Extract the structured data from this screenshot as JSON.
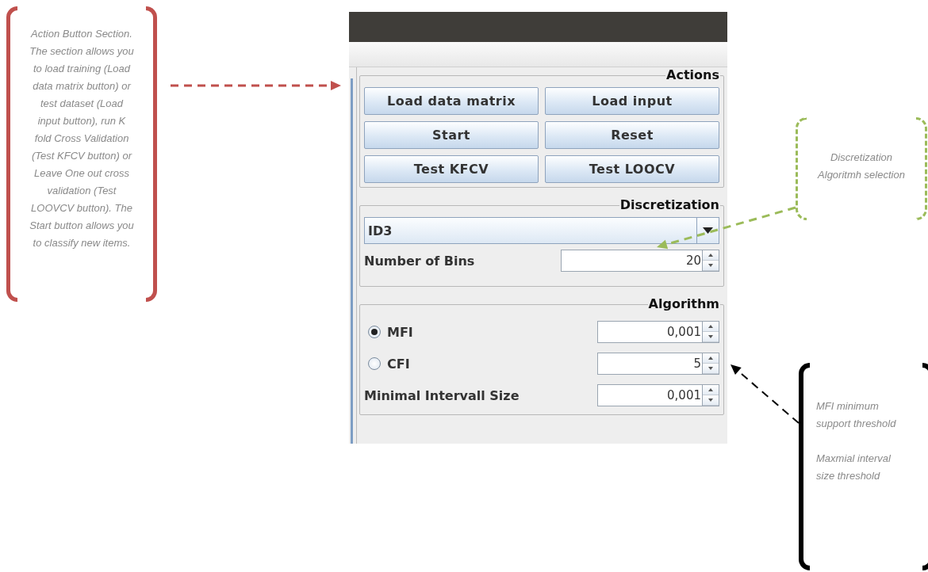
{
  "annotations": [
    {
      "color": "#c0504d",
      "kind": "solid",
      "paragraphs": [
        "Action Button Section. The section allows you to load training (Load data matrix button) or test dataset (Load input button), run K fold Cross Validation (Test KFCV button) or Leave One out cross validation (Test LOOVCV button). The Start button allows you to classify new items."
      ]
    },
    {
      "color": "#9bbb59",
      "kind": "dashed",
      "paragraphs": [
        "Discretization Algoritmh selection"
      ]
    },
    {
      "color": "#000000",
      "kind": "solid",
      "paragraphs": [
        "MFI minimum support threshold",
        "Maxmial interval size threshold"
      ]
    }
  ],
  "actions": {
    "title": "Actions",
    "buttons": [
      "Load data matrix",
      "Load input",
      "Start",
      "Reset",
      "Test KFCV",
      "Test LOOCV"
    ]
  },
  "discretization": {
    "title": "Discretization",
    "method": "ID3",
    "bins_label": "Number of Bins",
    "bins_value": "20"
  },
  "algorithm": {
    "title": "Algorithm",
    "options": [
      {
        "label": "MFI",
        "selected": true,
        "value": "0,001"
      },
      {
        "label": "CFI",
        "selected": false,
        "value": "5"
      }
    ],
    "interval_label": "Minimal Intervall Size",
    "interval_value": "0,001"
  }
}
